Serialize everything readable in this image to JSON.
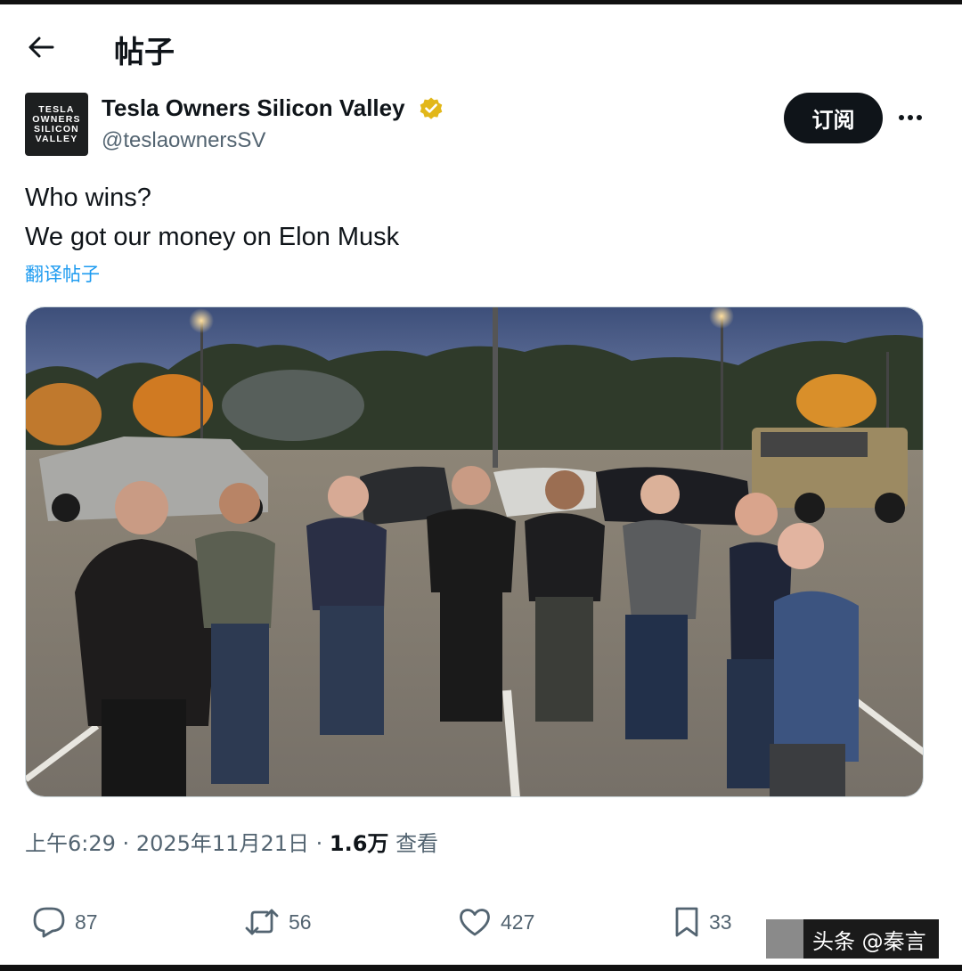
{
  "header": {
    "title": "帖子",
    "back_icon": "arrow-left-icon"
  },
  "author": {
    "avatar_text": "TESLA OWNERS SILICON VALLEY",
    "display_name": "Tesla Owners Silicon Valley",
    "handle": "@teslaownersSV",
    "verified_color": "#e2b719"
  },
  "subscribe_label": "订阅",
  "post": {
    "line1": "Who wins?",
    "line2": "We got our money on Elon Musk",
    "translate_label": "翻译帖子"
  },
  "meta": {
    "time": "上午6:29",
    "date": "2025年11月21日",
    "views_count": "1.6万",
    "views_label": "查看",
    "separator": "·"
  },
  "actions": {
    "replies": "87",
    "reposts": "56",
    "likes": "427",
    "bookmarks": "33"
  },
  "watermark": {
    "text": "头条 @秦言"
  },
  "colors": {
    "link": "#1d9bf0",
    "muted": "#536471",
    "text": "#0f1419"
  }
}
